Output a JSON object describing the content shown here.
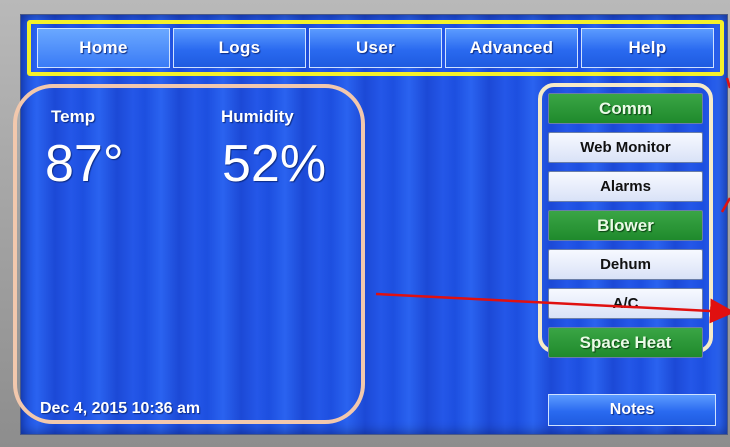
{
  "nav": {
    "tabs": [
      {
        "label": "Home"
      },
      {
        "label": "Logs"
      },
      {
        "label": "User"
      },
      {
        "label": "Advanced"
      },
      {
        "label": "Help"
      }
    ]
  },
  "readout": {
    "temp_label": "Temp",
    "temp_value": "87°",
    "humidity_label": "Humidity",
    "humidity_value": "52%",
    "timestamp": "Dec 4, 2015  10:36 am"
  },
  "panel": {
    "buttons": [
      {
        "label": "Comm",
        "style": "green"
      },
      {
        "label": "Web Monitor",
        "style": "light"
      },
      {
        "label": "Alarms",
        "style": "light"
      },
      {
        "label": "Blower",
        "style": "green"
      },
      {
        "label": "Dehum",
        "style": "light"
      },
      {
        "label": "A/C",
        "style": "light"
      },
      {
        "label": "Space Heat",
        "style": "green"
      }
    ]
  },
  "notes_label": "Notes",
  "colors": {
    "screen_blue": "#2457e8",
    "highlight_yellow": "#f5f12a",
    "highlight_cream": "#f6ebc8",
    "highlight_peach": "#f2c8ad",
    "annotation_red": "#e01010",
    "status_green": "#2a9a38"
  }
}
